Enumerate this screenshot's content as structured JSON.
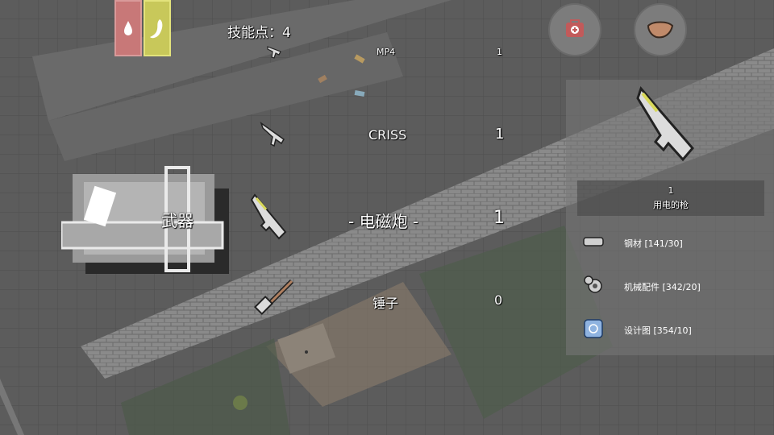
{
  "hud": {
    "skill_points": "技能点：4",
    "status_icons": [
      "blood-icon",
      "stomach-icon"
    ],
    "buttons": [
      "medkit-icon",
      "food-icon"
    ]
  },
  "category": {
    "label": "武器"
  },
  "weapons": [
    {
      "name": "MP4",
      "count": "1",
      "icon": "smg-icon"
    },
    {
      "name": "CRISS",
      "count": "1",
      "icon": "rifle-icon"
    },
    {
      "name": "- 电磁炮 -",
      "count": "1",
      "icon": "railgun-icon",
      "selected": true
    },
    {
      "name": "锤子",
      "count": "0",
      "icon": "hammer-icon"
    }
  ],
  "detail": {
    "count": "1",
    "description": "用电的枪",
    "materials": [
      {
        "label": "钢材 [141/30]",
        "icon": "steel-bar-icon"
      },
      {
        "label": "机械配件 [342/20]",
        "icon": "gear-parts-icon"
      },
      {
        "label": "设计图 [354/10]",
        "icon": "blueprint-icon"
      }
    ]
  },
  "colors": {
    "blood": "#c87878",
    "stomach": "#c8c85a",
    "panel": "#787878",
    "accent_yellow": "#d8d85a"
  }
}
